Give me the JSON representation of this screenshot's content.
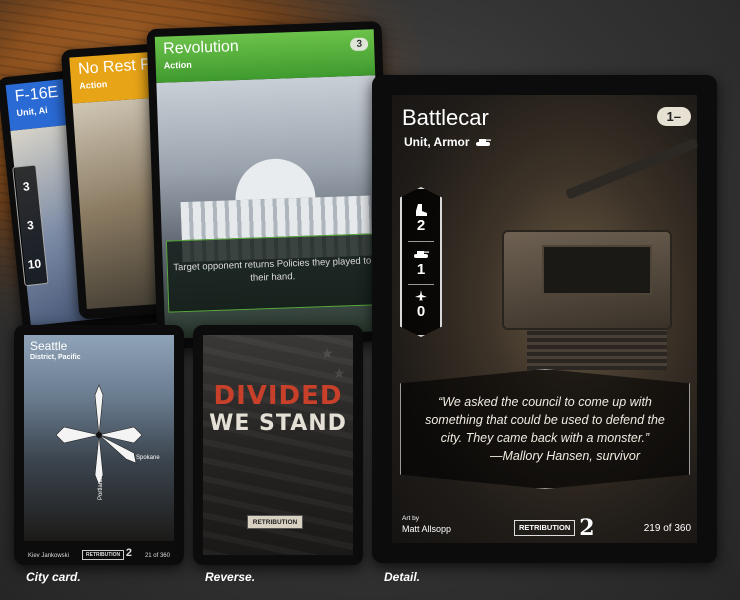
{
  "fan_cards": [
    {
      "title": "F-16E",
      "type": "Unit, Ai",
      "stats": [
        "3",
        "3",
        "10"
      ]
    },
    {
      "title": "No Rest F",
      "type": "Action"
    },
    {
      "title": "Revolution",
      "type": "Action",
      "cost": "3",
      "text": "Target opponent returns Policies they played to their hand."
    }
  ],
  "city_card": {
    "title": "Seattle",
    "subtitle": "District, Pacific",
    "labels": [
      "Spokane",
      "Portland"
    ],
    "artist": "Kiev Jankowski",
    "logo": "RETRIBUTION",
    "edition": "2",
    "number": "21 of 360"
  },
  "reverse_card": {
    "line1": "DIVIDED",
    "line2": "WE STAND",
    "logo": "RETRIBUTION"
  },
  "detail_card": {
    "title": "Battlecar",
    "type": "Unit, Armor",
    "cost": "1–",
    "stats": [
      {
        "icon": "boot-icon",
        "value": "2"
      },
      {
        "icon": "tank-icon",
        "value": "1"
      },
      {
        "icon": "jet-icon",
        "value": "0"
      }
    ],
    "quote": "“We asked the council to come up with something that could be used to defend the city. They came back with a monster.”",
    "attribution": "—Mallory Hansen, survivor",
    "art_by_label": "Art by",
    "artist": "Matt Allsopp",
    "logo": "RETRIBUTION",
    "edition": "2",
    "number": "219 of 360"
  },
  "captions": {
    "city": "City card.",
    "reverse": "Reverse.",
    "detail": "Detail."
  }
}
